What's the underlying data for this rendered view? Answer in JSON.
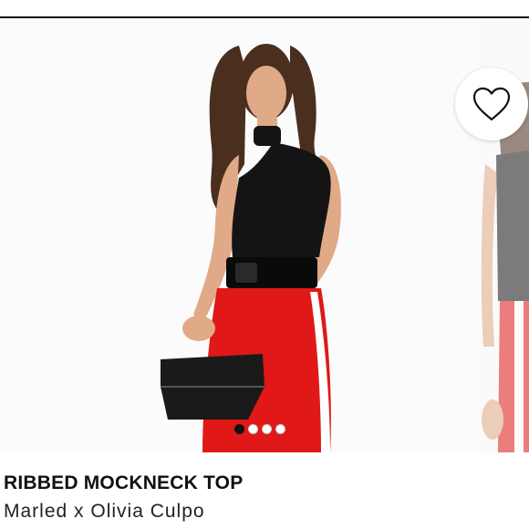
{
  "product": {
    "title": "RIBBED MOCKNECK TOP",
    "brand": "Marled x Olivia Culpo"
  },
  "gallery": {
    "image_count": 4,
    "active_index": 0,
    "favorite_icon": "heart-outline-icon"
  },
  "colors": {
    "top": "#141414",
    "pants_red": "#e01818",
    "pants_stripe": "#ffffff",
    "skin": "#e0a987",
    "hair": "#4a2e1e",
    "belt": "#0a0a0a",
    "clutch": "#1a1a1a",
    "active_dot": "#111111"
  }
}
